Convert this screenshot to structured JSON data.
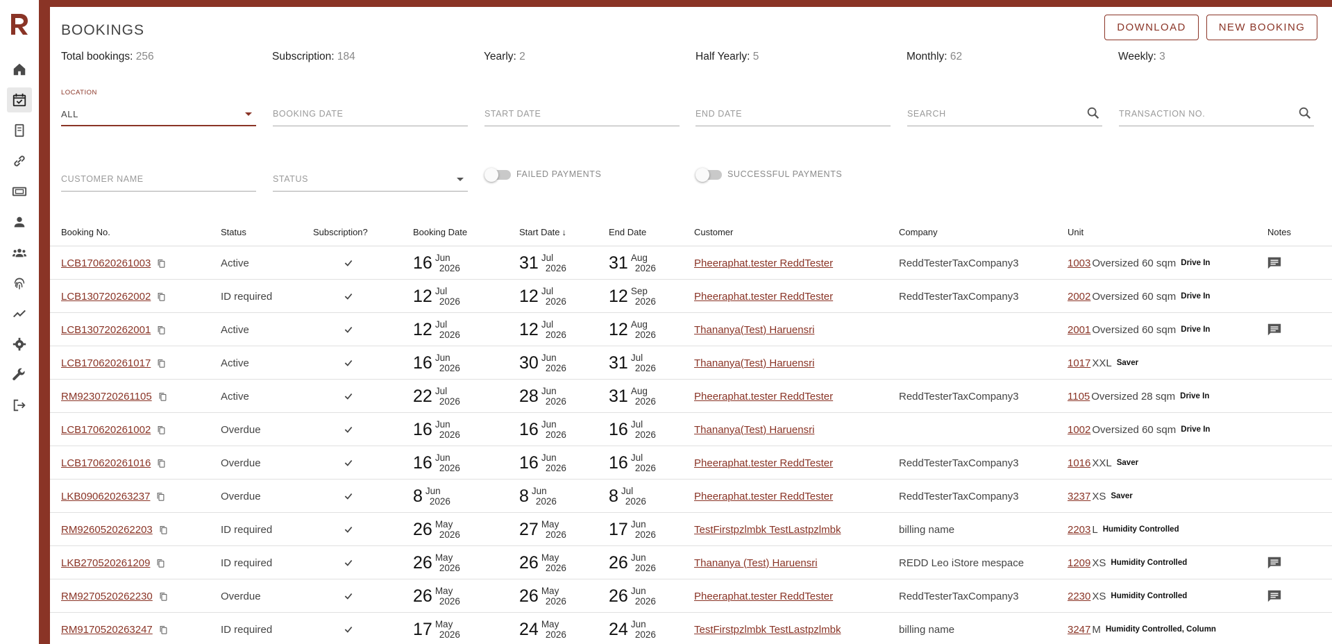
{
  "brand": {
    "color": "#8a3426",
    "logo_letter": "R"
  },
  "sidebar": {
    "items": [
      {
        "icon": "home-icon",
        "active": false
      },
      {
        "icon": "calendar-check-icon",
        "active": true
      },
      {
        "icon": "receipt-icon",
        "active": false
      },
      {
        "icon": "link-icon",
        "active": false
      },
      {
        "icon": "ticket-icon",
        "active": false
      },
      {
        "icon": "person-icon",
        "active": false
      },
      {
        "icon": "group-icon",
        "active": false
      },
      {
        "icon": "fingerprint-icon",
        "active": false
      },
      {
        "icon": "trending-up-icon",
        "active": false
      },
      {
        "icon": "settings-icon",
        "active": false
      },
      {
        "icon": "wrench-icon",
        "active": false
      },
      {
        "icon": "logout-icon",
        "active": false
      }
    ]
  },
  "header": {
    "title": "BOOKINGS",
    "download_label": "DOWNLOAD",
    "new_booking_label": "NEW BOOKING"
  },
  "stats": [
    {
      "label": "Total bookings:",
      "value": "256"
    },
    {
      "label": "Subscription:",
      "value": "184"
    },
    {
      "label": "Yearly:",
      "value": "2"
    },
    {
      "label": "Half Yearly:",
      "value": "5"
    },
    {
      "label": "Monthly:",
      "value": "62"
    },
    {
      "label": "Weekly:",
      "value": "3"
    }
  ],
  "filters": {
    "location_label": "LOCATION",
    "location_value": "ALL",
    "booking_date": "BOOKING DATE",
    "start_date": "START DATE",
    "end_date": "END DATE",
    "search": "SEARCH",
    "transaction_no": "TRANSACTION NO.",
    "customer_name": "CUSTOMER NAME",
    "status": "STATUS",
    "failed_payments": "FAILED PAYMENTS",
    "successful_payments": "SUCCESSFUL PAYMENTS"
  },
  "table": {
    "columns": [
      "Booking No.",
      "Status",
      "Subscription?",
      "Booking Date",
      "Start Date",
      "End Date",
      "Customer",
      "Company",
      "Unit",
      "Notes"
    ],
    "sort_indicator": "↓",
    "rows": [
      {
        "booking_no": "LCB170620261003",
        "status": "Active",
        "booking": [
          "16",
          "Jun",
          "2026"
        ],
        "start": [
          "31",
          "Jul",
          "2026"
        ],
        "end": [
          "31",
          "Aug",
          "2026"
        ],
        "customer": "Pheeraphat.tester ReddTester",
        "company": "ReddTesterTaxCompany3",
        "unit_no": "1003 ",
        "unit_type": "Oversized 60 sqm",
        "unit_tag": "Drive In",
        "note": true
      },
      {
        "booking_no": "LCB130720262002",
        "status": "ID required",
        "booking": [
          "12",
          "Jul",
          "2026"
        ],
        "start": [
          "12",
          "Jul",
          "2026"
        ],
        "end": [
          "12",
          "Sep",
          "2026"
        ],
        "customer": "Pheeraphat.tester ReddTester",
        "company": "ReddTesterTaxCompany3",
        "unit_no": "2002 ",
        "unit_type": "Oversized 60 sqm",
        "unit_tag": "Drive In",
        "note": false
      },
      {
        "booking_no": "LCB130720262001",
        "status": "Active",
        "booking": [
          "12",
          "Jul",
          "2026"
        ],
        "start": [
          "12",
          "Jul",
          "2026"
        ],
        "end": [
          "12",
          "Aug",
          "2026"
        ],
        "customer": "Thananya(Test) Haruensri",
        "company": "",
        "unit_no": "2001 ",
        "unit_type": "Oversized 60 sqm",
        "unit_tag": "Drive In",
        "note": true
      },
      {
        "booking_no": "LCB170620261017",
        "status": "Active",
        "booking": [
          "16",
          "Jun",
          "2026"
        ],
        "start": [
          "30",
          "Jun",
          "2026"
        ],
        "end": [
          "31",
          "Jul",
          "2026"
        ],
        "customer": "Thananya(Test) Haruensri",
        "company": "",
        "unit_no": "1017 ",
        "unit_type": "XXL",
        "unit_tag": "Saver",
        "note": false
      },
      {
        "booking_no": "RM9230720261105",
        "status": "Active",
        "booking": [
          "22",
          "Jul",
          "2026"
        ],
        "start": [
          "28",
          "Jun",
          "2026"
        ],
        "end": [
          "31",
          "Aug",
          "2026"
        ],
        "customer": "Pheeraphat.tester ReddTester",
        "company": "ReddTesterTaxCompany3",
        "unit_no": "1105 ",
        "unit_type": "Oversized 28 sqm",
        "unit_tag": "Drive In",
        "note": false
      },
      {
        "booking_no": "LCB170620261002",
        "status": "Overdue",
        "booking": [
          "16",
          "Jun",
          "2026"
        ],
        "start": [
          "16",
          "Jun",
          "2026"
        ],
        "end": [
          "16",
          "Jul",
          "2026"
        ],
        "customer": "Thananya(Test) Haruensri",
        "company": "",
        "unit_no": "1002 ",
        "unit_type": "Oversized 60 sqm",
        "unit_tag": "Drive In",
        "note": false
      },
      {
        "booking_no": "LCB170620261016",
        "status": "Overdue",
        "booking": [
          "16",
          "Jun",
          "2026"
        ],
        "start": [
          "16",
          "Jun",
          "2026"
        ],
        "end": [
          "16",
          "Jul",
          "2026"
        ],
        "customer": "Pheeraphat.tester ReddTester",
        "company": "ReddTesterTaxCompany3",
        "unit_no": "1016 ",
        "unit_type": "XXL",
        "unit_tag": "Saver",
        "note": false
      },
      {
        "booking_no": "LKB090620263237",
        "status": "Overdue",
        "booking": [
          "8",
          "Jun",
          "2026"
        ],
        "start": [
          "8",
          "Jun",
          "2026"
        ],
        "end": [
          "8",
          "Jul",
          "2026"
        ],
        "customer": "Pheeraphat.tester ReddTester",
        "company": "ReddTesterTaxCompany3",
        "unit_no": "3237 ",
        "unit_type": "XS",
        "unit_tag": "Saver",
        "note": false
      },
      {
        "booking_no": "RM9260520262203",
        "status": "ID required",
        "booking": [
          "26",
          "May",
          "2026"
        ],
        "start": [
          "27",
          "May",
          "2026"
        ],
        "end": [
          "17",
          "Jun",
          "2026"
        ],
        "customer": "TestFirstpzlmbk TestLastpzlmbk",
        "company": "billing name",
        "unit_no": "2203 ",
        "unit_type": "L",
        "unit_tag": "Humidity Controlled",
        "note": false
      },
      {
        "booking_no": "LKB270520261209",
        "status": "ID required",
        "booking": [
          "26",
          "May",
          "2026"
        ],
        "start": [
          "26",
          "May",
          "2026"
        ],
        "end": [
          "26",
          "Jun",
          "2026"
        ],
        "customer": "Thananya (Test) Haruensri",
        "company": "REDD Leo iStore mespace",
        "unit_no": "1209 ",
        "unit_type": "XS",
        "unit_tag": "Humidity Controlled",
        "note": true
      },
      {
        "booking_no": "RM9270520262230",
        "status": "Overdue",
        "booking": [
          "26",
          "May",
          "2026"
        ],
        "start": [
          "26",
          "May",
          "2026"
        ],
        "end": [
          "26",
          "Jun",
          "2026"
        ],
        "customer": "Pheeraphat.tester ReddTester",
        "company": "ReddTesterTaxCompany3",
        "unit_no": "2230 ",
        "unit_type": "XS",
        "unit_tag": "Humidity Controlled",
        "note": true
      },
      {
        "booking_no": "RM9170520263247",
        "status": "ID required",
        "booking": [
          "17",
          "May",
          "2026"
        ],
        "start": [
          "24",
          "May",
          "2026"
        ],
        "end": [
          "24",
          "Jun",
          "2026"
        ],
        "customer": "TestFirstpzlmbk TestLastpzlmbk",
        "company": "billing name",
        "unit_no": "3247 ",
        "unit_type": "M",
        "unit_tag": "Humidity Controlled, Column",
        "note": false
      }
    ]
  }
}
